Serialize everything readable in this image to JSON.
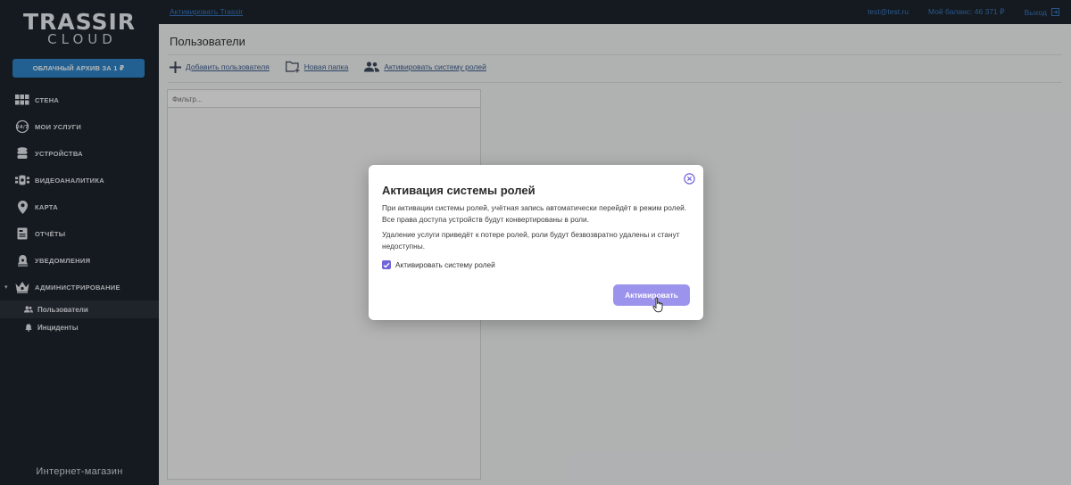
{
  "sidebar": {
    "logo_top": "TRASSIR",
    "logo_bottom": "CLOUD",
    "promo_button": "ОБЛАЧНЫЙ АРХИВ ЗА 1 ₽",
    "items": [
      {
        "label": "СТЕНА",
        "icon": "wall-icon"
      },
      {
        "label": "МОИ УСЛУГИ",
        "icon": "services-24-7-icon"
      },
      {
        "label": "УСТРОЙСТВА",
        "icon": "devices-icon"
      },
      {
        "label": "ВИДЕОАНАЛИТИКА",
        "icon": "analytics-icon"
      },
      {
        "label": "КАРТА",
        "icon": "map-pin-icon"
      },
      {
        "label": "ОТЧЁТЫ",
        "icon": "reports-icon"
      },
      {
        "label": "УВЕДОМЛЕНИЯ",
        "icon": "bell-icon"
      },
      {
        "label": "АДМИНИСТРИРОВАНИЕ",
        "icon": "crown-icon"
      }
    ],
    "subitems": [
      {
        "label": "Пользователи",
        "icon": "users-icon",
        "active": true
      },
      {
        "label": "Инциденты",
        "icon": "bell-icon",
        "active": false
      }
    ],
    "shop_label": "Интернет-магазин"
  },
  "topbar": {
    "activate_link": "Активировать Trassir",
    "email": "test@test.ru",
    "balance": "Мой баланс: 46 371 ₽",
    "logout": "Выход"
  },
  "main": {
    "title": "Пользователи",
    "toolbar": {
      "add_user": "Добавить пользователя",
      "new_folder": "Новая папка",
      "activate_roles": "Активировать систему ролей"
    },
    "filter_placeholder": "Фильтр..."
  },
  "modal": {
    "title": "Активация системы ролей",
    "paragraph1": "При активации системы ролей, учётная запись автоматически перейдёт в режим ролей. Все права доступа устройств будут конвертированы в роли.",
    "paragraph2": "Удаление услуги приведёт к потере ролей, роли будут безвозвратно удалены и станут недоступны.",
    "checkbox_label": "Активировать систему ролей",
    "checkbox_checked": true,
    "activate_button": "Активировать"
  },
  "colors": {
    "sidebar_bg": "#1d242d",
    "promo_blue": "#2f86c9",
    "accent_purple": "#6f64d8",
    "button_purple": "#9c94ec",
    "link_blue": "#3b78c0"
  }
}
